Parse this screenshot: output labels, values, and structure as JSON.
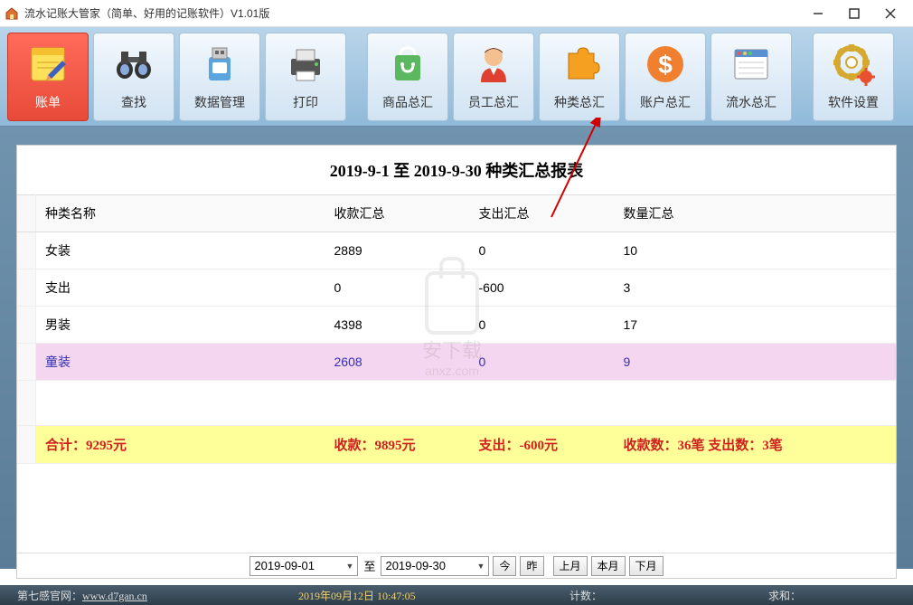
{
  "window": {
    "title": "流水记账大管家（简单、好用的记账软件）V1.01版"
  },
  "toolbar": [
    {
      "id": "bill",
      "label": "账单",
      "active": true
    },
    {
      "id": "search",
      "label": "查找"
    },
    {
      "id": "data",
      "label": "数据管理"
    },
    {
      "id": "print",
      "label": "打印"
    },
    {
      "id": "goods",
      "label": "商品总汇"
    },
    {
      "id": "staff",
      "label": "员工总汇"
    },
    {
      "id": "category",
      "label": "种类总汇"
    },
    {
      "id": "account",
      "label": "账户总汇"
    },
    {
      "id": "flow",
      "label": "流水总汇"
    },
    {
      "id": "settings",
      "label": "软件设置"
    }
  ],
  "report": {
    "title": "2019-9-1 至 2019-9-30 种类汇总报表",
    "headers": [
      "种类名称",
      "收款汇总",
      "支出汇总",
      "数量汇总"
    ],
    "rows": [
      {
        "name": "女装",
        "in": "2889",
        "out": "0",
        "qty": "10"
      },
      {
        "name": "支出",
        "in": "0",
        "out": "-600",
        "qty": "3"
      },
      {
        "name": "男装",
        "in": "4398",
        "out": "0",
        "qty": "17"
      },
      {
        "name": "童装",
        "in": "2608",
        "out": "0",
        "qty": "9",
        "selected": true
      }
    ],
    "totals": {
      "sum": "合计：9295元",
      "in": "收款：9895元",
      "out": "支出：-600元",
      "qty": "收款数：36笔  支出数：3笔"
    }
  },
  "dateBar": {
    "from": "2019-09-01",
    "to": "2019-09-30",
    "sep": "至",
    "today": "今",
    "yesterday": "昨",
    "lastMonth": "上月",
    "thisMonth": "本月",
    "nextMonth": "下月"
  },
  "status": {
    "site_label": "第七感官网：",
    "site": "www.d7gan.cn",
    "datetime": "2019年09月12日  10:47:05",
    "count_label": "计数：",
    "sum_label": "求和："
  },
  "watermark": {
    "text1": "安下载",
    "text2": "anxz.com"
  }
}
